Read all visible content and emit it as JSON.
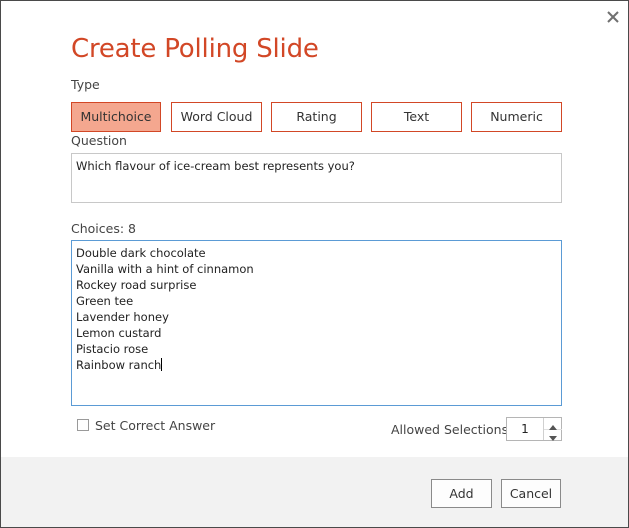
{
  "dialog": {
    "title": "Create Polling Slide",
    "close_icon": "close-icon"
  },
  "type_section": {
    "label": "Type",
    "options": [
      {
        "label": "Multichoice",
        "selected": true
      },
      {
        "label": "Word Cloud",
        "selected": false
      },
      {
        "label": "Rating",
        "selected": false
      },
      {
        "label": "Text",
        "selected": false
      },
      {
        "label": "Numeric",
        "selected": false
      }
    ]
  },
  "question": {
    "label": "Question",
    "value": "Which flavour of ice-cream best represents you?"
  },
  "choices": {
    "label": "Choices: 8",
    "items": [
      "Double dark chocolate",
      "Vanilla with a hint of cinnamon",
      "Rockey road surprise",
      "Green tee",
      "Lavender honey",
      "Lemon custard",
      "Pistacio rose",
      "Rainbow ranch"
    ]
  },
  "set_correct_answer": {
    "label": "Set Correct Answer",
    "checked": false
  },
  "allowed_selections": {
    "label": "Allowed Selections:",
    "value": "1"
  },
  "footer": {
    "add_label": "Add",
    "cancel_label": "Cancel"
  },
  "colors": {
    "accent": "#d24726",
    "selected_fill": "#f4a78f",
    "focus_border": "#5b9bd5",
    "footer_bg": "#f2f2f2"
  }
}
